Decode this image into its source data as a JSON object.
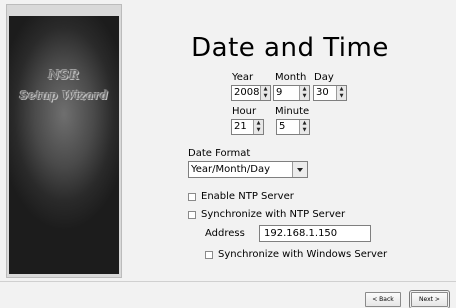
{
  "banner": {
    "line1": "NSR",
    "line2": "Setup Wizard"
  },
  "title": "Date and Time",
  "date": {
    "year_label": "Year",
    "month_label": "Month",
    "day_label": "Day",
    "year": "2008",
    "month": "9",
    "day": "30"
  },
  "time": {
    "hour_label": "Hour",
    "minute_label": "Minute",
    "hour": "21",
    "minute": "5"
  },
  "date_format": {
    "label": "Date Format",
    "selected": "Year/Month/Day"
  },
  "ntp": {
    "enable_label": "Enable NTP Server",
    "enable_checked": false,
    "sync_label": "Synchronize with NTP Server",
    "sync_checked": false,
    "address_label": "Address",
    "address_value": "192.168.1.150",
    "windows_label": "Synchronize with Windows Server",
    "windows_checked": false
  },
  "buttons": {
    "back": "< Back",
    "next": "Next >"
  }
}
